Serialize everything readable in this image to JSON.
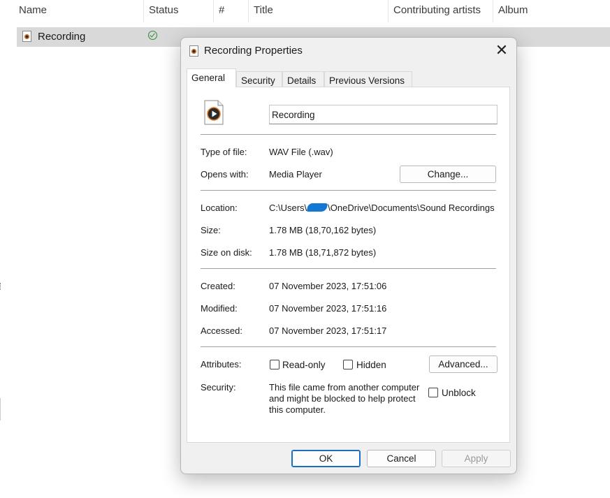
{
  "explorer": {
    "columns": [
      {
        "label": "Name"
      },
      {
        "label": "Status"
      },
      {
        "label": "#"
      },
      {
        "label": "Title"
      },
      {
        "label": "Contributing artists"
      },
      {
        "label": "Album"
      }
    ],
    "row": {
      "name": "Recording",
      "status": "synced"
    }
  },
  "dialog": {
    "title": "Recording Properties",
    "close_glyph": "✕",
    "tabs": [
      "General",
      "Security",
      "Details",
      "Previous Versions"
    ],
    "active_tab": "General",
    "file_name": "Recording",
    "type_label": "Type of file:",
    "type_value": "WAV File (.wav)",
    "opens_label": "Opens with:",
    "opens_value": "Media Player",
    "change_button": "Change...",
    "location_label": "Location:",
    "location_prefix": "C:\\Users\\",
    "location_suffix": "\\OneDrive\\Documents\\Sound Recordings",
    "size_label": "Size:",
    "size_value": "1.78 MB (18,70,162 bytes)",
    "size_disk_label": "Size on disk:",
    "size_disk_value": "1.78 MB (18,71,872 bytes)",
    "created_label": "Created:",
    "created_value": "07 November 2023, 17:51:06",
    "modified_label": "Modified:",
    "modified_value": "07 November 2023, 17:51:16",
    "accessed_label": "Accessed:",
    "accessed_value": "07 November 2023, 17:51:17",
    "attributes_label": "Attributes:",
    "readonly_label": "Read-only",
    "hidden_label": "Hidden",
    "advanced_button": "Advanced...",
    "security_label": "Security:",
    "security_text": "This file came from another computer and might be blocked to help protect this computer.",
    "unblock_label": "Unblock",
    "readonly_checked": false,
    "hidden_checked": false,
    "unblock_checked": false,
    "ok_button": "OK",
    "cancel_button": "Cancel",
    "apply_button": "Apply"
  },
  "colors": {
    "accent": "#1a6fc4",
    "redaction": "#1477d4",
    "selection": "#d9d9d9"
  },
  "icons": [
    "media-file-icon",
    "sync-status-check-icon",
    "close-icon",
    "sort-caret-icon"
  ]
}
